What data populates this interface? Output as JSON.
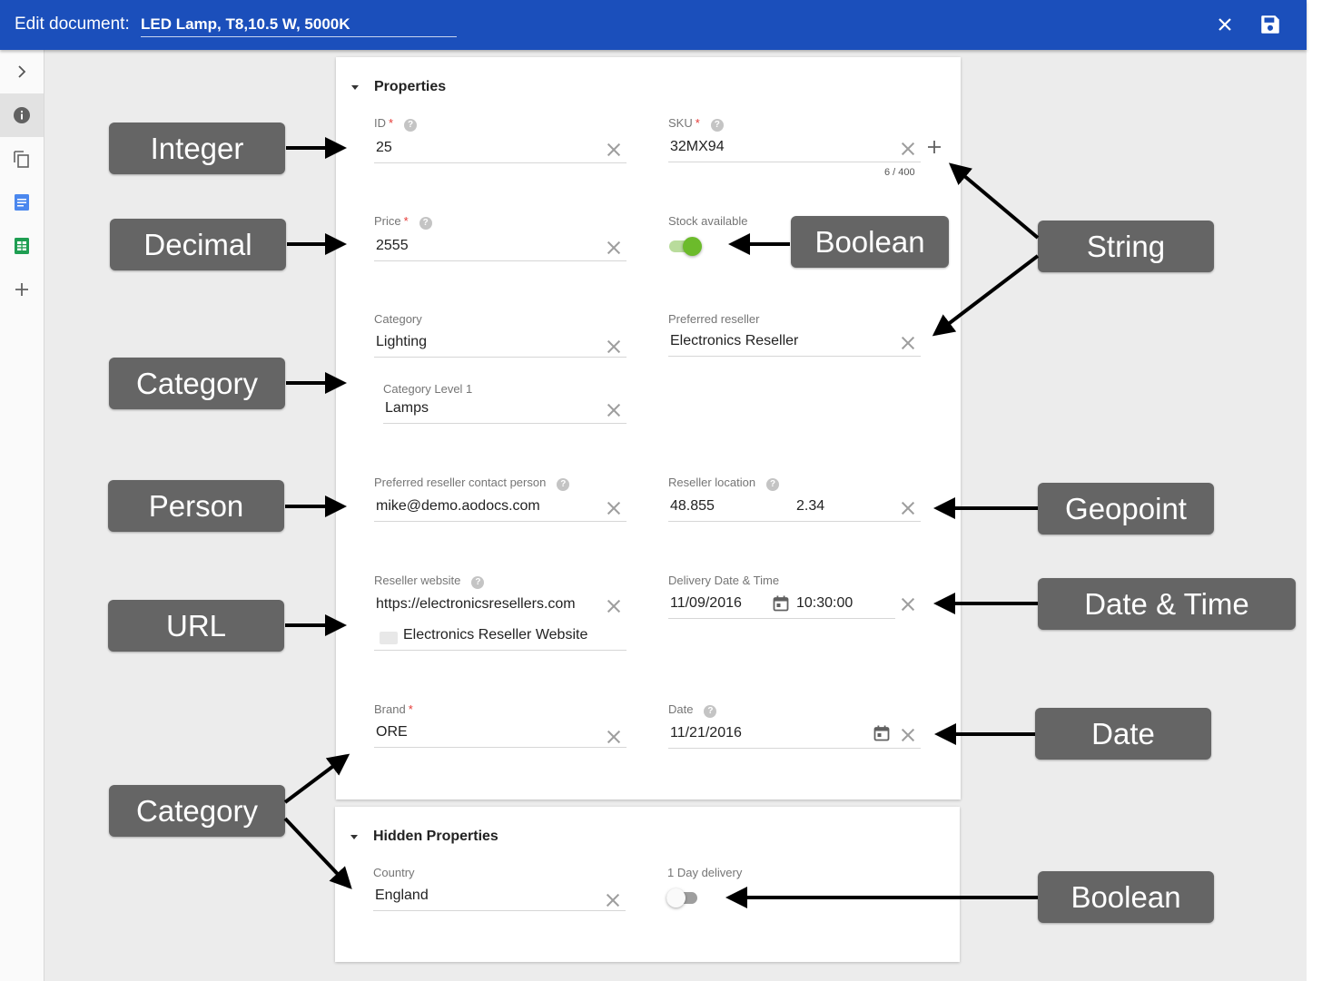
{
  "header": {
    "edit_label": "Edit document:",
    "document_title": "LED Lamp, T8,10.5 W, 5000K",
    "close_icon": "close-icon",
    "save_icon": "save-icon",
    "color": "#1b4fbb"
  },
  "rail": [
    "chevron-right-icon",
    "info-icon",
    "copy-icon",
    "doc-icon",
    "sheet-icon",
    "plus-icon"
  ],
  "sections": {
    "properties": "Properties",
    "hidden": "Hidden Properties"
  },
  "fields": {
    "id": {
      "label": "ID",
      "value": "25"
    },
    "sku": {
      "label": "SKU",
      "value": "32MX94",
      "counter": "6 / 400"
    },
    "price": {
      "label": "Price",
      "value": "2555"
    },
    "stock": {
      "label": "Stock available",
      "on": true
    },
    "category": {
      "label": "Category",
      "value": "Lighting"
    },
    "category_level1": {
      "label": "Category Level 1",
      "value": "Lamps"
    },
    "preferred_reseller": {
      "label": "Preferred reseller",
      "value": "Electronics Reseller"
    },
    "contact_person": {
      "label": "Preferred reseller contact person",
      "value": "mike@demo.aodocs.com"
    },
    "reseller_location": {
      "label": "Reseller location",
      "lat": "48.855",
      "lng": "2.34"
    },
    "reseller_website": {
      "label": "Reseller website",
      "url": "https://electronicsresellers.com",
      "text": "Electronics Reseller Website"
    },
    "delivery": {
      "label": "Delivery Date & Time",
      "date": "11/09/2016",
      "time": "10:30:00"
    },
    "brand": {
      "label": "Brand",
      "value": "ORE"
    },
    "date": {
      "label": "Date",
      "value": "11/21/2016"
    },
    "country": {
      "label": "Country",
      "value": "England"
    },
    "one_day_delivery": {
      "label": "1 Day delivery",
      "on": false
    }
  },
  "annotations": {
    "integer": "Integer",
    "decimal": "Decimal",
    "category": "Category",
    "person": "Person",
    "url": "URL",
    "category2": "Category",
    "boolean": "Boolean",
    "string": "String",
    "geopoint": "Geopoint",
    "datetime": "Date & Time",
    "date": "Date",
    "boolean2": "Boolean"
  },
  "colors": {
    "toggle_on": "#6cbb2b",
    "accent": "#1b4fbb",
    "annotation": "#656565"
  }
}
